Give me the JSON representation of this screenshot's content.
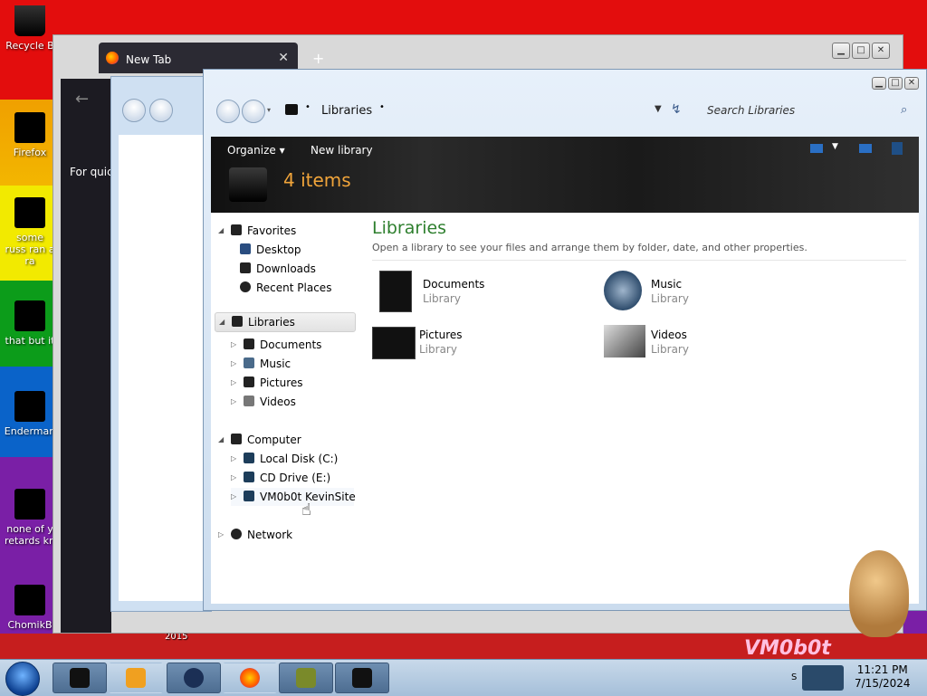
{
  "desktop": {
    "icons": [
      {
        "label": "Recycle B",
        "name": "recycle-bin-icon"
      },
      {
        "label": "Firefox",
        "name": "firefox-shortcut-icon"
      },
      {
        "label": "some russ ran a ra",
        "name": "desktop-file-icon"
      },
      {
        "label": "that but it",
        "name": "desktop-file-icon-2"
      },
      {
        "label": "Enderman",
        "name": "enderman-shortcut-icon"
      },
      {
        "label": "none of y retards kn",
        "name": "desktop-file-icon-3"
      },
      {
        "label": "ChomikB",
        "name": "chomik-shortcut-icon"
      }
    ],
    "wallpaper_text": "VM0b0t",
    "wallpaper_year": "2015"
  },
  "browser": {
    "tab_title": "New Tab",
    "quick_text": "For quick"
  },
  "explorer": {
    "address": "Libraries",
    "search_placeholder": "Search Libraries",
    "toolbar": {
      "organize": "Organize",
      "new_library": "New library"
    },
    "item_count": "4 items",
    "tree": {
      "favorites": "Favorites",
      "desktop": "Desktop",
      "downloads": "Downloads",
      "recent_places": "Recent Places",
      "libraries": "Libraries",
      "documents": "Documents",
      "music": "Music",
      "pictures": "Pictures",
      "videos": "Videos",
      "computer": "Computer",
      "local_disk": "Local Disk (C:)",
      "cd_drive": "CD Drive (E:)",
      "vm_share": "VM0b0t KevinSite",
      "network": "Network"
    },
    "heading": "Libraries",
    "description": "Open a library to see your files and arrange them by folder, date, and other properties.",
    "libraries": [
      {
        "name": "Documents",
        "type": "Library"
      },
      {
        "name": "Music",
        "type": "Library"
      },
      {
        "name": "Pictures",
        "type": "Library"
      },
      {
        "name": "Videos",
        "type": "Library"
      }
    ]
  },
  "taskbar": {
    "time": "11:21 PM",
    "date": "7/15/2024",
    "tray_letter": "S"
  }
}
